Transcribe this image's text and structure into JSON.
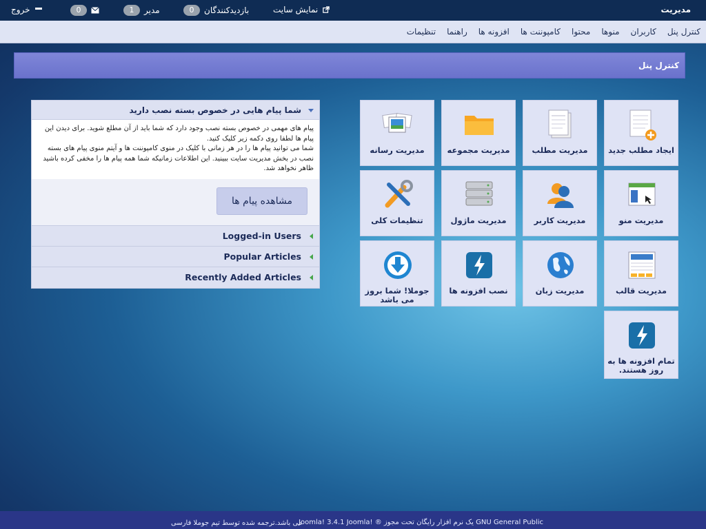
{
  "topbar": {
    "brand": "مدیریت",
    "view_site": "نمایش سایت",
    "visitors_label": "بازدیدکنندگان",
    "visitors_count": "0",
    "admins_label": "مدیر",
    "admins_count": "1",
    "messages_count": "0",
    "logout": "خروج"
  },
  "menu": {
    "items": [
      "کنترل پنل",
      "کاربران",
      "منوها",
      "محتوا",
      "کامپوننت ها",
      "افزونه ها",
      "راهنما",
      "تنظیمات"
    ]
  },
  "page": {
    "title": "کنترل پنل"
  },
  "tiles": [
    {
      "label": "ایجاد مطلب جدید",
      "icon": "new-article-icon"
    },
    {
      "label": "مدیریت مطلب",
      "icon": "article-manager-icon"
    },
    {
      "label": "مدیریت مجموعه",
      "icon": "folder-icon"
    },
    {
      "label": "مدیریت رسانه",
      "icon": "media-icon"
    },
    {
      "label": "مدیریت منو",
      "icon": "menu-window-icon"
    },
    {
      "label": "مدیریت کاربر",
      "icon": "users-icon"
    },
    {
      "label": "مدیریت ماژول",
      "icon": "module-stack-icon"
    },
    {
      "label": "تنظیمات کلی",
      "icon": "tools-icon"
    },
    {
      "label": "مدیریت قالب",
      "icon": "template-icon"
    },
    {
      "label": "مدیریت زبان",
      "icon": "globe-icon"
    },
    {
      "label": "نصب افزونه ها",
      "icon": "lightning-icon"
    },
    {
      "label": "جوملا! شما بروز می باشد",
      "icon": "download-icon"
    },
    {
      "label": "تمام افزونه ها به روز هستند.",
      "icon": "lightning-icon"
    }
  ],
  "panel": {
    "title": "شما پیام هایی در خصوص بسته نصب دارید",
    "body": "پیام های مهمی در خصوص بسته نصب وجود دارد که شما باید از آن مطلع شوید. برای دیدن این پیام ها لطفا روی دکمه زیر کلیک کنید.\nشما می توانید پیام ها را در هر زمانی با کلیک در منوی کامپوننت ها و آیتم منوی پیام های بسته نصب در بخش مدیریت سایت ببینید. این اطلاعات زمانیکه شما همه پیام ها را مخفی کرده باشید ظاهر نخواهد شد.",
    "button": "مشاهده پیام ها",
    "sections": [
      "Logged-in Users",
      "Popular Articles",
      "Recently Added Articles"
    ]
  },
  "footer": {
    "line1": "Joomla! 3.4.1   Joomla! ®  یک نرم افزار رایگان تحت مجوز GNU General Public",
    "line2": "می باشد.ترجمه شده توسط تیم جوملا فارسی"
  },
  "colors": {
    "topbar": "#0f2c54",
    "menubar": "#dfe4f4",
    "titlebar": "#6a72cc",
    "tile": "#dfe3f5",
    "footer": "#2a3688"
  }
}
